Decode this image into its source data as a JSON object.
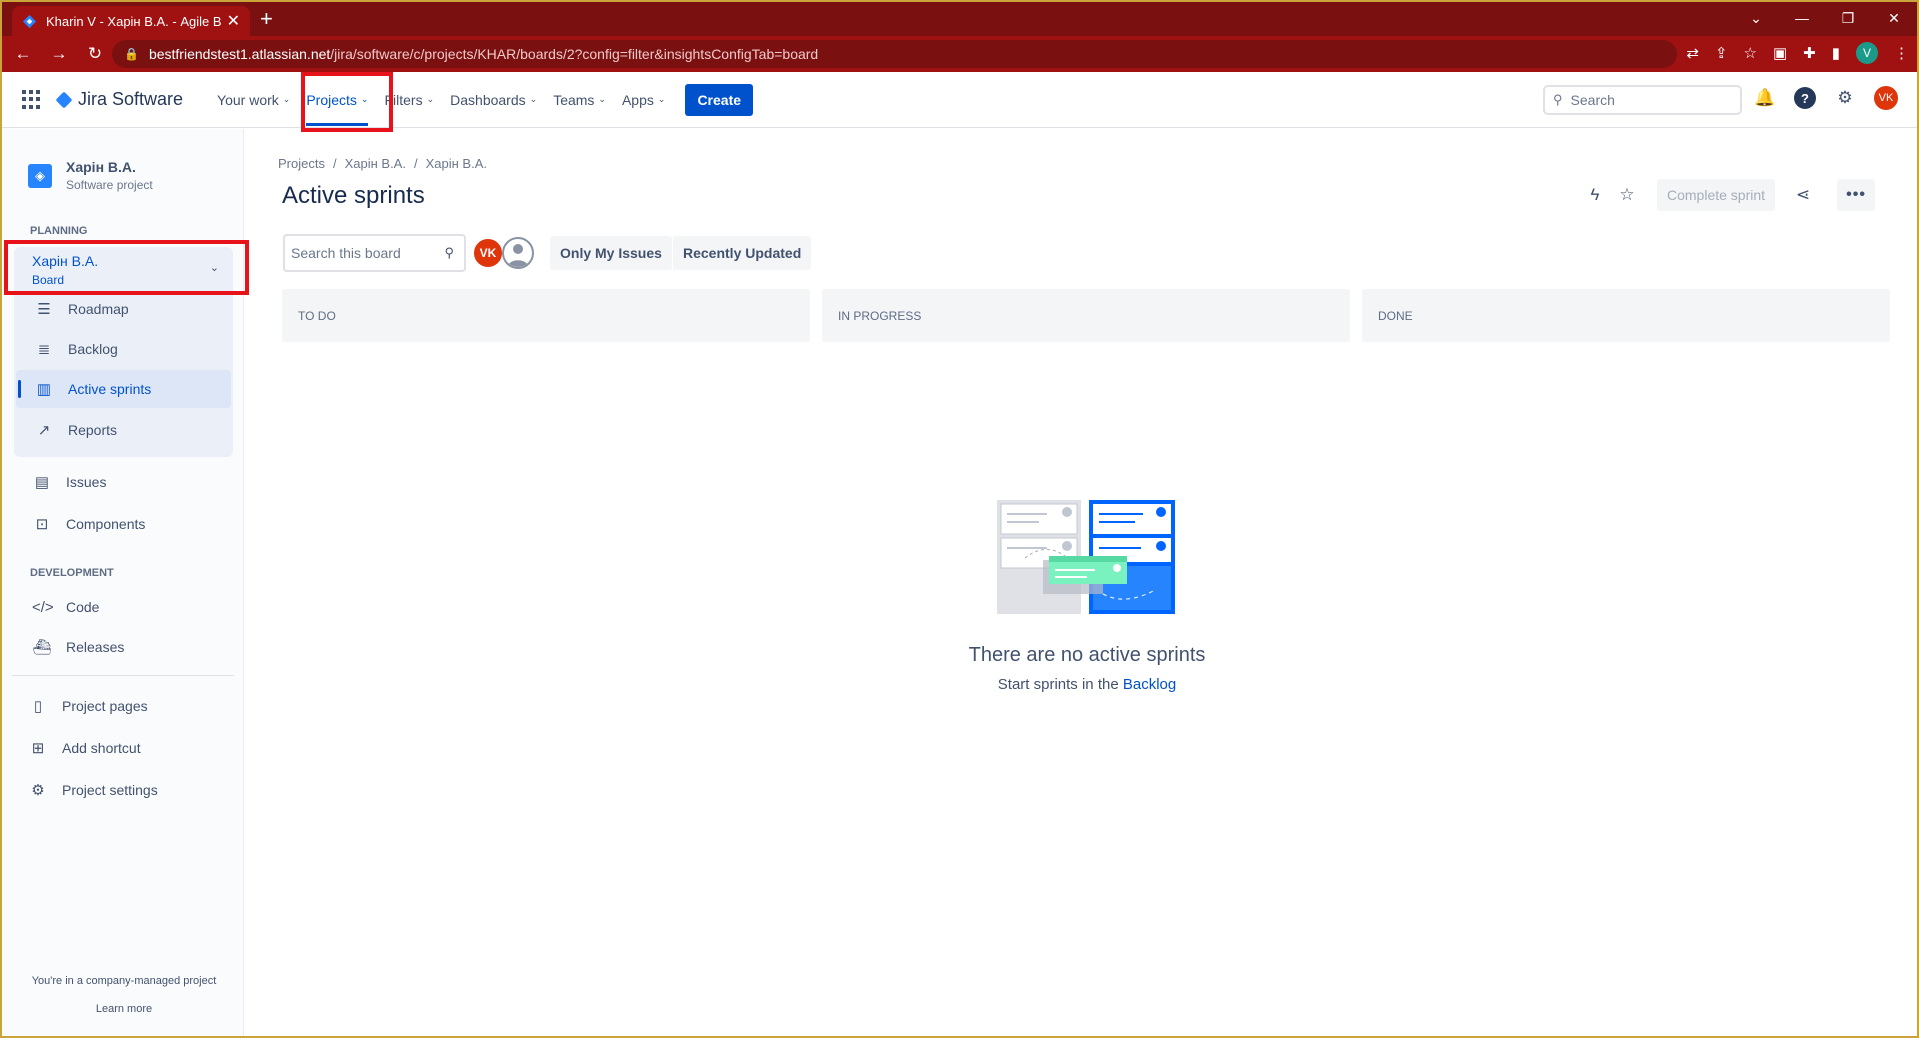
{
  "browser": {
    "tab_title": "Kharin V - Харін В.А. - Agile Boar",
    "url_host": "bestfriendstest1.atlassian.net",
    "url_path": "/jira/software/c/projects/KHAR/boards/2?config=filter&insightsConfigTab=board",
    "profile_initial": "V"
  },
  "topnav": {
    "logo": "Jira Software",
    "items": [
      {
        "label": "Your work"
      },
      {
        "label": "Projects"
      },
      {
        "label": "Filters"
      },
      {
        "label": "Dashboards"
      },
      {
        "label": "Teams"
      },
      {
        "label": "Apps"
      }
    ],
    "create_label": "Create",
    "search_placeholder": "Search",
    "user_initials": "VK"
  },
  "sidebar": {
    "project_name": "Харін В.А.",
    "project_type": "Software project",
    "planning_heading": "PLANNING",
    "board_name": "Харін В.А.",
    "board_type": "Board",
    "planning_items": [
      {
        "label": "Roadmap",
        "icon": "roadmap-icon"
      },
      {
        "label": "Backlog",
        "icon": "backlog-icon"
      },
      {
        "label": "Active sprints",
        "icon": "board-icon"
      },
      {
        "label": "Reports",
        "icon": "reports-icon"
      }
    ],
    "other_items": [
      {
        "label": "Issues",
        "icon": "issues-icon"
      },
      {
        "label": "Components",
        "icon": "components-icon"
      }
    ],
    "development_heading": "DEVELOPMENT",
    "development_items": [
      {
        "label": "Code",
        "icon": "code-icon"
      },
      {
        "label": "Releases",
        "icon": "releases-icon"
      }
    ],
    "bottom_items": [
      {
        "label": "Project pages",
        "icon": "pages-icon"
      },
      {
        "label": "Add shortcut",
        "icon": "add-shortcut-icon"
      },
      {
        "label": "Project settings",
        "icon": "gear-icon"
      }
    ],
    "footer_text": "You're in a company-managed project",
    "footer_link": "Learn more"
  },
  "main": {
    "breadcrumbs": [
      "Projects",
      "/",
      "Харін В.А.",
      "/",
      "Харін В.А."
    ],
    "title": "Active sprints",
    "complete_sprint_label": "Complete sprint",
    "board_search_placeholder": "Search this board",
    "avatar_initials": "VK",
    "filters": [
      "Only My Issues",
      "Recently Updated"
    ],
    "columns": [
      "TO DO",
      "IN PROGRESS",
      "DONE"
    ],
    "empty_title": "There are no active sprints",
    "empty_text": "Start sprints in the",
    "empty_link": "Backlog"
  },
  "colors": {
    "browser_theme": "#a01212",
    "accent": "#0052cc",
    "highlight_box": "#e8131a",
    "avatar_red": "#de350b"
  }
}
